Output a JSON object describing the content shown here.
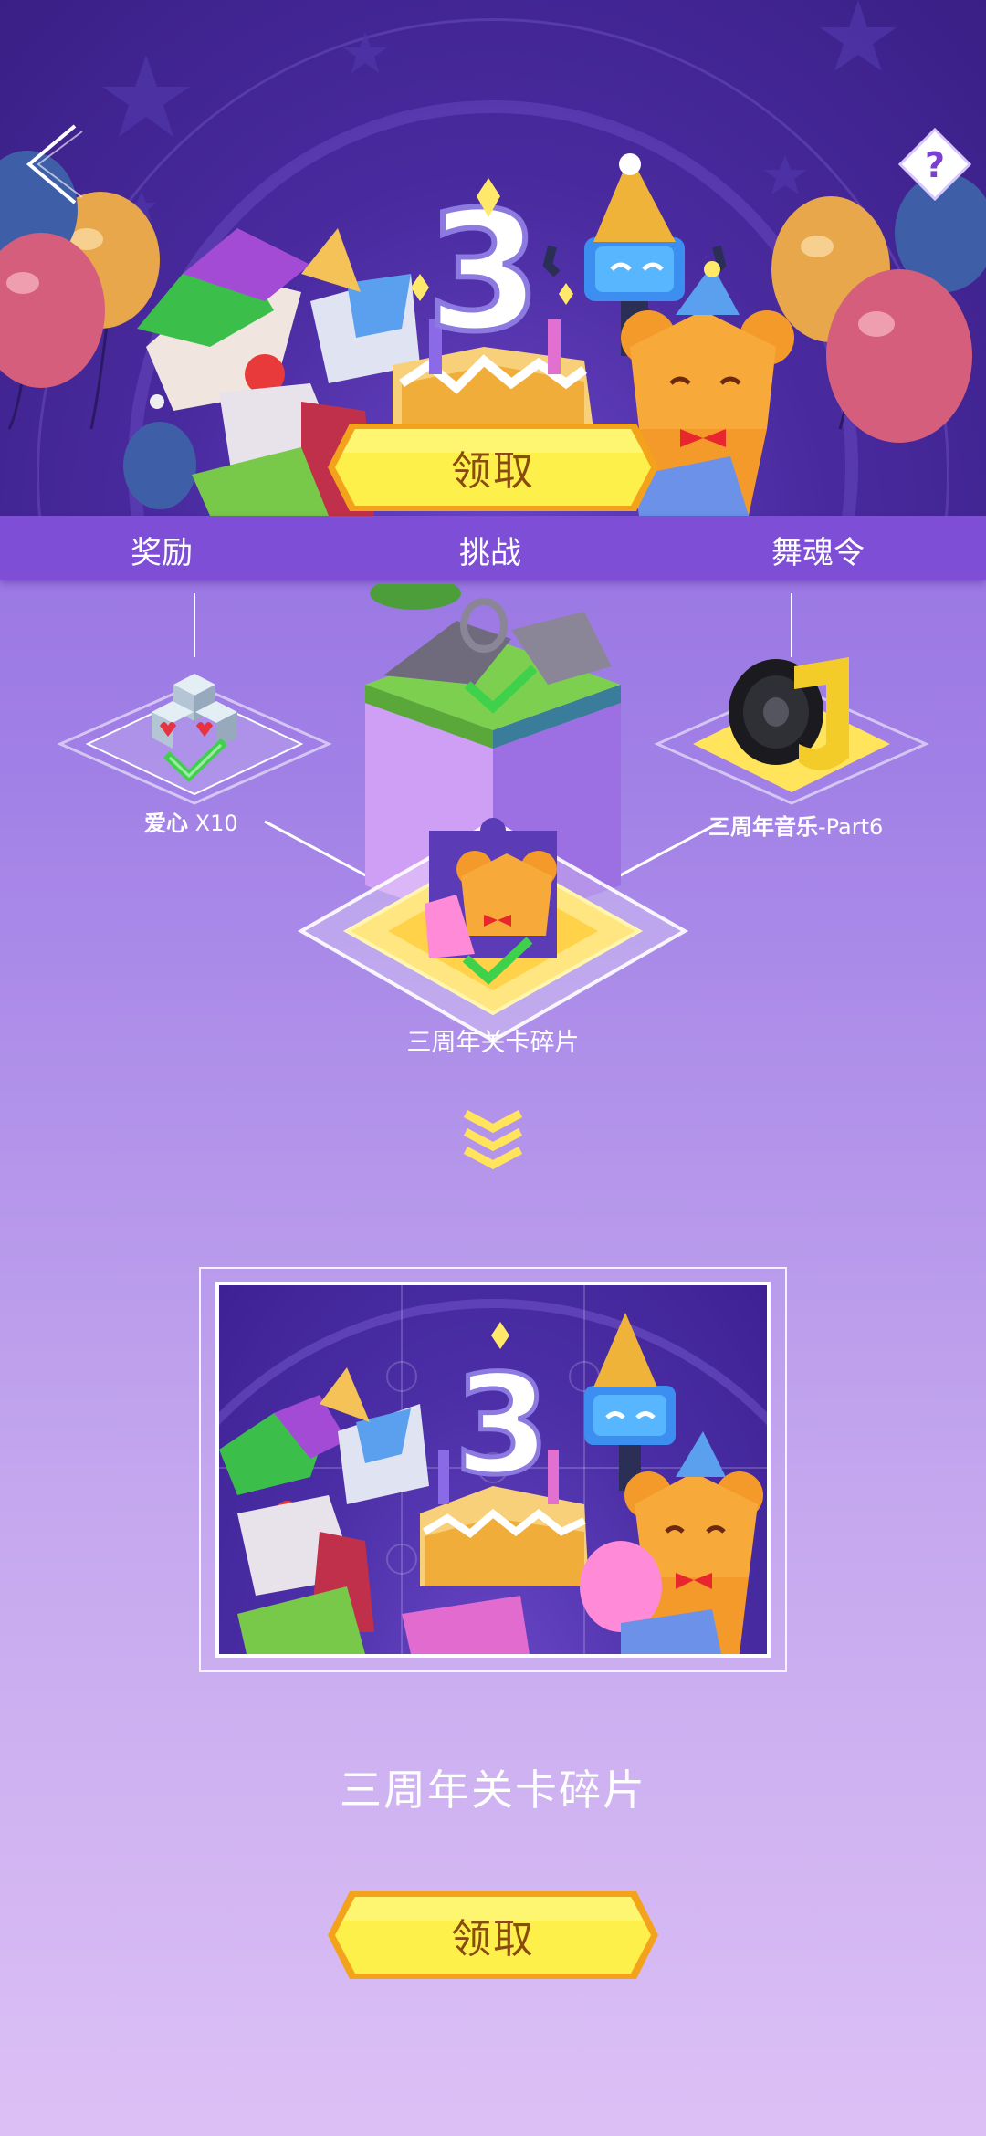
{
  "banner": {
    "badge_number": "3",
    "claim_label": "领取"
  },
  "tabs": [
    {
      "label": "奖励"
    },
    {
      "label": "挑战"
    },
    {
      "label": "舞魂令"
    }
  ],
  "rewards": {
    "hearts": {
      "name": "爱心",
      "count": "X10",
      "claimed": true
    },
    "music": {
      "name_bold": "三周年音乐",
      "name_suffix": "-Part6",
      "claimed": false
    },
    "fragment": {
      "name": "三周年关卡碎片",
      "claimed": true
    }
  },
  "detail": {
    "title": "三周年关卡碎片",
    "claim_label": "领取"
  },
  "colors": {
    "accent_yellow": "#fdf04a",
    "button_border": "#f3a21c",
    "check_green": "#3fd14b",
    "tab_bg": "#7e4fd6"
  }
}
